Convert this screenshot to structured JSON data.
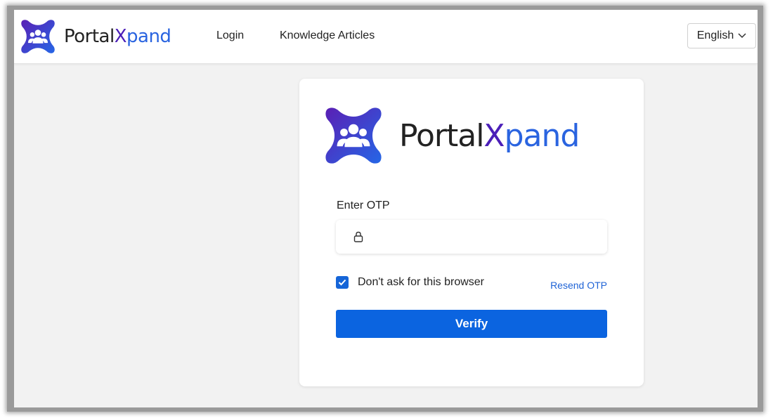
{
  "header": {
    "brand": {
      "part1": "Portal",
      "part2": "X",
      "part3": "pand"
    },
    "nav": {
      "login": "Login",
      "knowledge_articles": "Knowledge Articles"
    },
    "language": {
      "selected": "English"
    }
  },
  "login_card": {
    "brand": {
      "part1": "Portal",
      "part2": "X",
      "part3": "pand"
    },
    "otp": {
      "label": "Enter OTP",
      "value": "",
      "placeholder": ""
    },
    "remember": {
      "label": "Don't ask for this browser",
      "checked": true
    },
    "resend_label": "Resend OTP",
    "verify_label": "Verify"
  },
  "icons": {
    "logo": "portalxpand-logo-icon",
    "lock": "lock-icon",
    "chevron": "chevron-down-icon",
    "check": "checkmark-icon"
  },
  "colors": {
    "brand_purple": "#4b1fb8",
    "brand_blue": "#2a64e0",
    "primary_button": "#0b64e0",
    "link": "#1f63d6",
    "page_background": "#f2f2f2"
  }
}
